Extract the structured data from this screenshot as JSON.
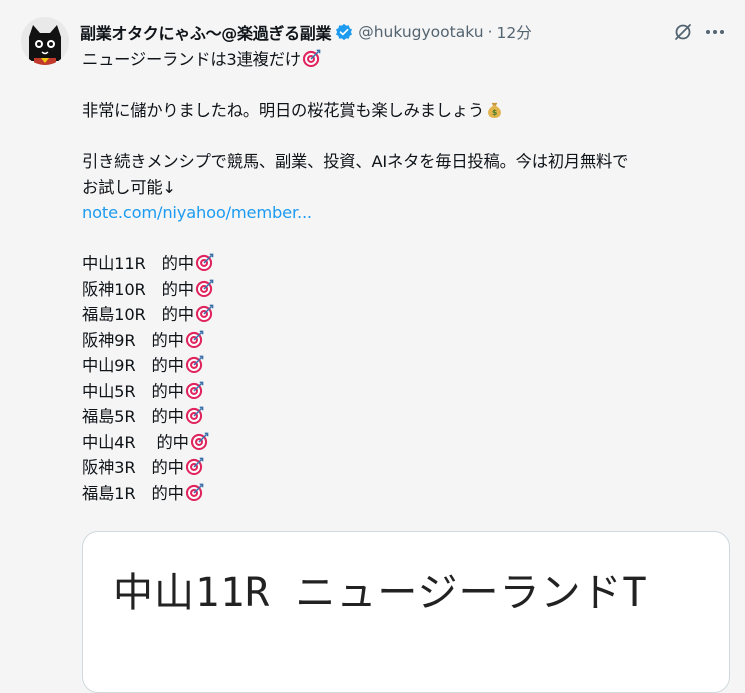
{
  "author": {
    "display_name": "副業オタクにゃふ〜@楽過ぎる副業",
    "handle": "@hukugyootaku",
    "separator": "·",
    "time": "12分",
    "avatar_icon": "black-cat-avatar",
    "verified_icon": "verified-badge-icon"
  },
  "post": {
    "line1": "ニュージーランドは3連複だけ",
    "line2": "非常に儲かりましたね。明日の桜花賞も楽しみましょう",
    "line3": "引き続きメンシプで競馬、副業、投資、AIネタを毎日投稿。今は初月無料で",
    "line4": "お試し可能↓",
    "link": "note.com/niyahoo/member...",
    "results": [
      "中山11R　的中",
      "阪神10R　的中",
      "福島10R　的中",
      "阪神9R　的中",
      "中山9R　的中",
      "中山5R　的中",
      "福島5R　的中",
      "中山4R　 的中",
      "阪神3R　的中",
      "福島1R　的中"
    ]
  },
  "card": {
    "image_text": "中山11R ニュージーランドT"
  },
  "icons": {
    "target": "direct-hit-target-icon",
    "money": "money-bag-icon",
    "grok": "grok-icon",
    "more": "more-options-icon"
  },
  "colors": {
    "link": "#1d9bf0",
    "verified": "#1d9bf0",
    "secondary_text": "#536471",
    "target_red": "#e0245e"
  }
}
